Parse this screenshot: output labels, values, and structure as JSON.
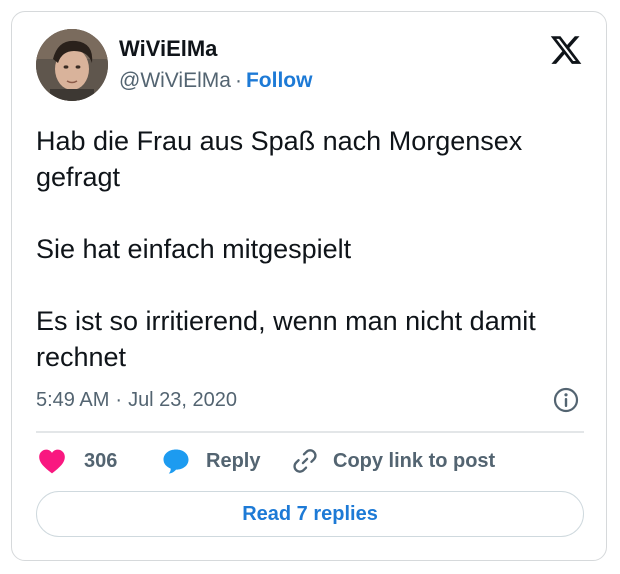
{
  "author": {
    "display_name": "WiViElMa",
    "handle": "@WiViElMa",
    "separator": "·",
    "follow_label": "Follow"
  },
  "tweet": {
    "lines": [
      "Hab die Frau aus Spaß nach Morgensex gefragt",
      "Sie hat einfach mitgespielt",
      "Es ist so irritierend, wenn man nicht damit rechnet"
    ],
    "time": "5:49 AM",
    "date": "Jul 23, 2020",
    "separator": "·"
  },
  "actions": {
    "like_count": "306",
    "reply_label": "Reply",
    "copy_label": "Copy link to post"
  },
  "read_replies_label": "Read 7 replies",
  "icons": {
    "brand": "x-logo-icon",
    "like": "heart-icon",
    "reply": "speech-bubble-icon",
    "copy": "link-icon",
    "info": "info-icon"
  },
  "colors": {
    "accent": "#1d7ad6",
    "like": "#f91880",
    "reply": "#1d9bf0",
    "muted": "#536471",
    "text": "#0f1419"
  }
}
